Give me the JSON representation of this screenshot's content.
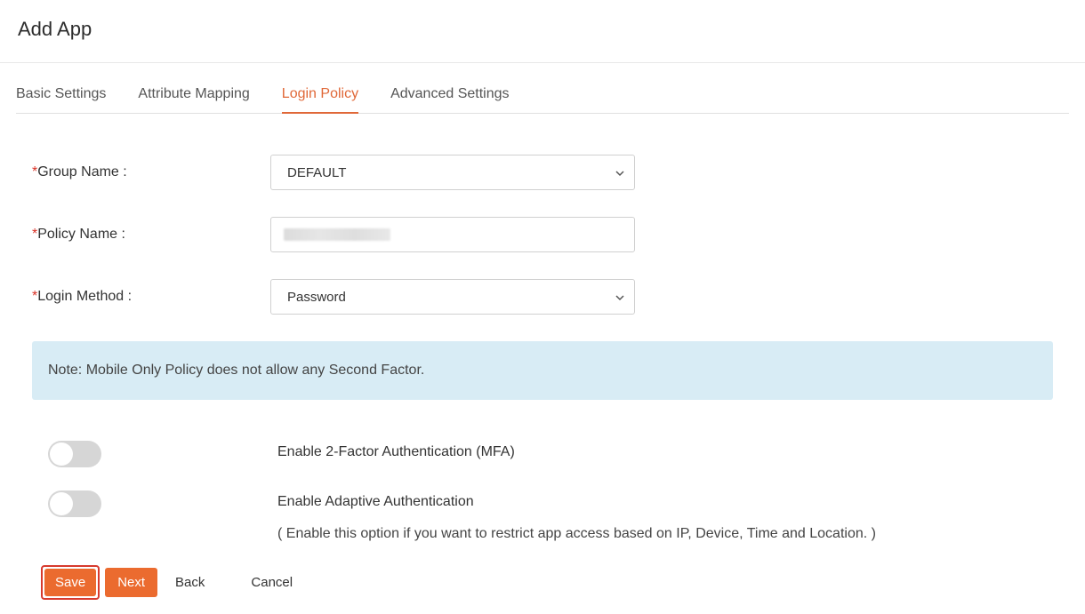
{
  "header": {
    "title": "Add App"
  },
  "tabs": [
    {
      "label": "Basic Settings",
      "active": false
    },
    {
      "label": "Attribute Mapping",
      "active": false
    },
    {
      "label": "Login Policy",
      "active": true
    },
    {
      "label": "Advanced Settings",
      "active": false
    }
  ],
  "form": {
    "groupName": {
      "label": "Group Name :",
      "value": "DEFAULT"
    },
    "policyName": {
      "label": "Policy Name :",
      "value": ""
    },
    "loginMethod": {
      "label": "Login Method :",
      "value": "Password"
    }
  },
  "note": "Note: Mobile Only Policy does not allow any Second Factor.",
  "toggles": {
    "mfa": {
      "label": "Enable 2-Factor Authentication (MFA)",
      "enabled": false
    },
    "adaptive": {
      "label": "Enable Adaptive Authentication",
      "sublabel": "( Enable this option if you want to restrict app access based on IP, Device, Time and Location. )",
      "enabled": false
    }
  },
  "buttons": {
    "save": "Save",
    "next": "Next",
    "back": "Back",
    "cancel": "Cancel"
  }
}
